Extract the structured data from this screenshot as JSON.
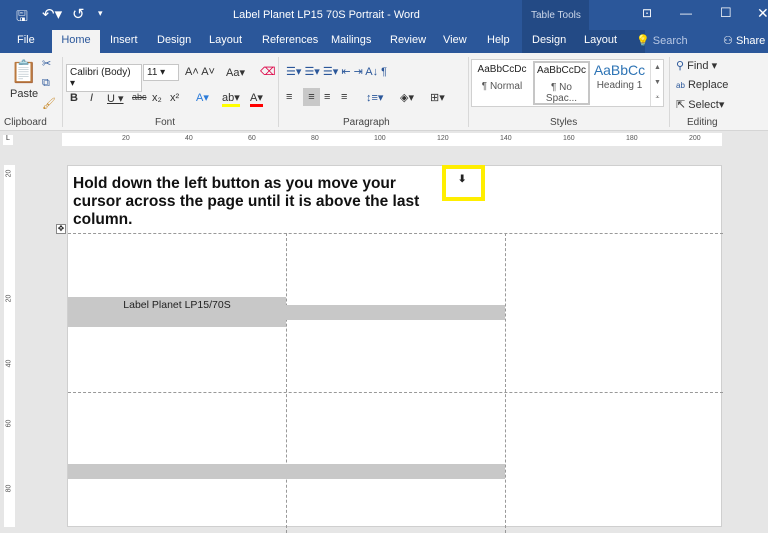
{
  "window": {
    "title": "Label Planet LP15 70S Portrait  -  Word",
    "context": "Table Tools"
  },
  "quick_access": [
    "save-icon",
    "undo-icon",
    "redo-icon",
    "customize-icon"
  ],
  "tabs": [
    "File",
    "Home",
    "Insert",
    "Design",
    "Layout",
    "References",
    "Mailings",
    "Review",
    "View",
    "Help",
    "Design",
    "Layout"
  ],
  "search": "Search",
  "share": "Share",
  "clipboard": {
    "paste": "Paste",
    "label": "Clipboard"
  },
  "font": {
    "name": "Calibri (Body)",
    "size": "11",
    "label": "Font",
    "aa": "Aa"
  },
  "paragraph": {
    "label": "Paragraph"
  },
  "styles": {
    "items": [
      {
        "sample": "AaBbCcDc",
        "name": "¶ Normal"
      },
      {
        "sample": "AaBbCcDc",
        "name": "¶ No Spac..."
      },
      {
        "sample": "AaBbCc",
        "name": "Heading 1"
      }
    ],
    "label": "Styles"
  },
  "editing": {
    "find": "Find",
    "replace": "Replace",
    "select": "Select",
    "label": "Editing"
  },
  "ruler": [
    "20",
    "40",
    "60",
    "80",
    "100",
    "120",
    "140",
    "160",
    "180",
    "200"
  ],
  "vruler": [
    "20",
    "20",
    "40",
    "60",
    "80"
  ],
  "document": {
    "instruction": "Hold down the left button as you move your cursor across the page until it is above the last column.",
    "cell_label": "Label Planet LP15/70S"
  },
  "colors": {
    "brand": "#2b579a",
    "highlight": "#ffff00",
    "font_color": "#ff0000",
    "cursor_box": "#ffee00"
  }
}
